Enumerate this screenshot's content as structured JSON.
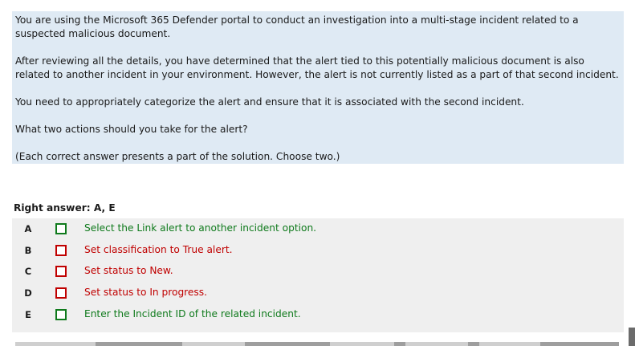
{
  "question": {
    "p1": "You are using the Microsoft 365 Defender portal to conduct an investigation into a multi-stage incident related to a suspected malicious document.",
    "p2": "After reviewing all the details, you have determined that the alert tied to this potentially malicious document is also related to another incident in your environment. However, the alert is not currently listed as a part of that second incident.",
    "p3": "You need to appropriately categorize the alert and ensure that it is associated with the second incident.",
    "p4": "What two actions should you take for the alert?",
    "p5": "(Each correct answer presents a part of the solution. Choose two.)"
  },
  "answer": {
    "label": "Right answer: A, E"
  },
  "options": [
    {
      "letter": "A",
      "text": "Select the Link alert to another incident option.",
      "correct": true
    },
    {
      "letter": "B",
      "text": "Set classification to True alert.",
      "correct": false
    },
    {
      "letter": "C",
      "text": "Set status to New.",
      "correct": false
    },
    {
      "letter": "D",
      "text": "Set status to In progress.",
      "correct": false
    },
    {
      "letter": "E",
      "text": "Enter the Incident ID of the related incident.",
      "correct": true
    }
  ],
  "colors": {
    "question_bg": "#dfeaf4",
    "options_bg": "#efefef",
    "correct": "#0f7a1c",
    "incorrect": "#c00000"
  }
}
